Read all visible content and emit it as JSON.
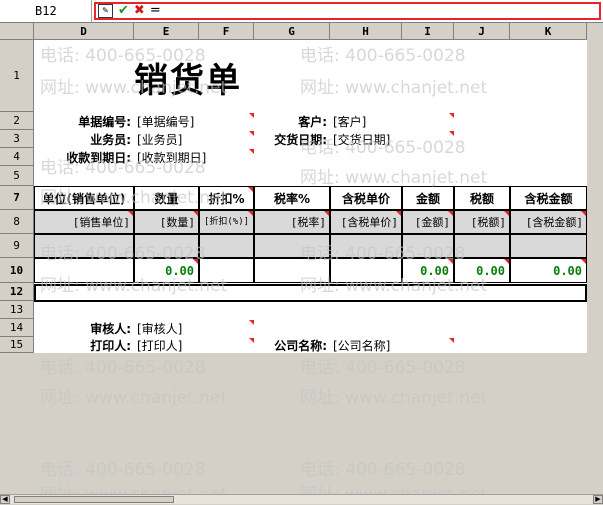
{
  "cell_ref": "B12",
  "formula_bar": {
    "eq": "="
  },
  "columns": [
    "D",
    "E",
    "F",
    "G",
    "H",
    "I",
    "J",
    "K"
  ],
  "rows": [
    "1",
    "2",
    "3",
    "4",
    "5",
    "7",
    "8",
    "9",
    "10",
    "12",
    "13",
    "14",
    "15"
  ],
  "title": "销货单",
  "header_fields": {
    "doc_no_label": "单据编号:",
    "doc_no_value": "[单据编号]",
    "customer_label": "客户:",
    "customer_value": "[客户]",
    "clerk_label": "业务员:",
    "clerk_value": "[业务员]",
    "delivery_date_label": "交货日期:",
    "delivery_date_value": "[交货日期]",
    "due_date_label": "收款到期日:",
    "due_date_value": "[收款到期日]"
  },
  "table_headers": [
    "单位(销售单位)",
    "数量",
    "折扣%",
    "税率%",
    "含税单价",
    "金额",
    "税额",
    "含税金额"
  ],
  "table_fields": [
    "[销售单位]",
    "[数量]",
    "[折扣(%)]",
    "[税率]",
    "[含税单价]",
    "[金额]",
    "[税额]",
    "[含税金额]"
  ],
  "totals": {
    "qty": "0.00",
    "amount": "0.00",
    "tax": "0.00",
    "total": "0.00"
  },
  "footer_fields": {
    "auditor_label": "审核人:",
    "auditor_value": "[审核人]",
    "printer_label": "打印人:",
    "printer_value": "[打印人]",
    "company_label": "公司名称:",
    "company_value": "[公司名称]"
  },
  "watermark": {
    "phone": "电话: 400-665-0028",
    "site": "网址: www.chanjet.net"
  }
}
